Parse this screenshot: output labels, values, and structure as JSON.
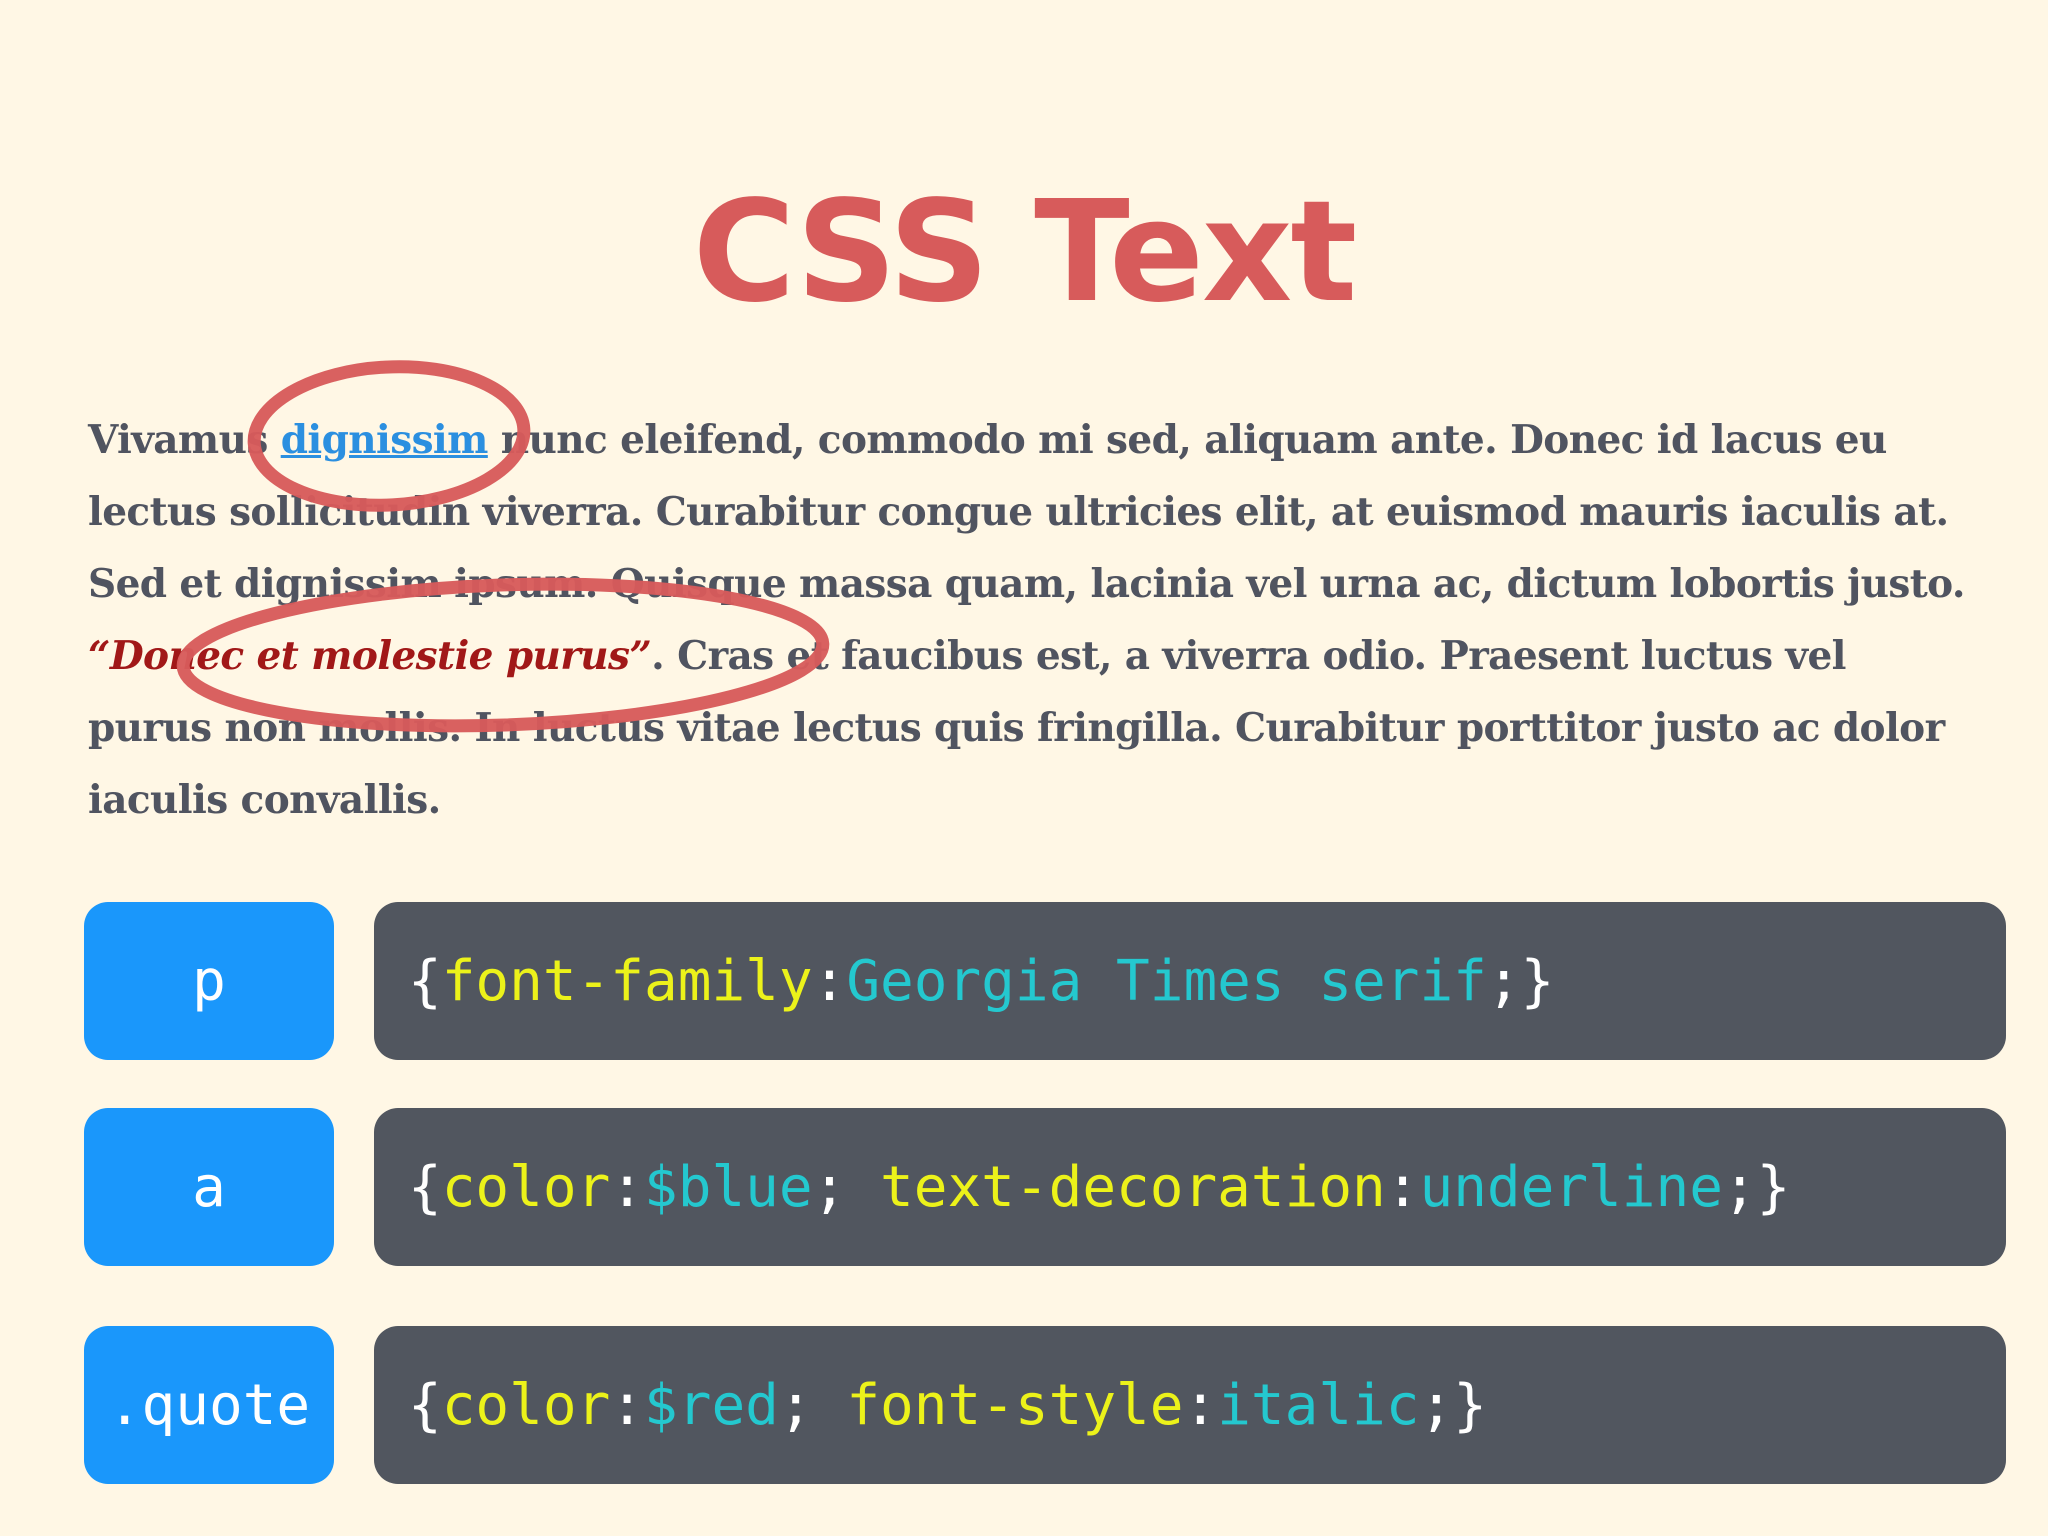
{
  "title": "CSS Text",
  "paragraph": {
    "before_link": "Vivamus ",
    "link": "dignissim",
    "after_link": " nunc eleifend, commodo mi sed, aliquam ante. Donec id lacus eu lectus sollicitudin viverra. Curabitur congue ultricies elit, at euismod mauris iaculis at. Sed et dignissim ipsum. Quisque massa quam, lacinia vel urna ac, dictum lobortis justo. ",
    "quote": "“Donec et molestie purus”",
    "after_quote": ". Cras et faucibus est, a viverra odio. Praesent luctus vel purus non mollis. In luctus vitae lectus quis fringilla. Curabitur porttitor justo ac dolor iaculis convallis."
  },
  "rules": [
    {
      "selector": "p",
      "open": "{",
      "prop1": "font-family",
      "colon1": ":",
      "val1": "Georgia Times serif",
      "semi1": ";",
      "prop2": "",
      "colon2": "",
      "val2": "",
      "semi2": "",
      "close": "}"
    },
    {
      "selector": "a",
      "open": "{",
      "prop1": "color",
      "colon1": ":",
      "val1": "$blue",
      "semi1": "; ",
      "prop2": "text-decoration",
      "colon2": ":",
      "val2": "underline",
      "semi2": ";",
      "close": "}"
    },
    {
      "selector": ".quote",
      "open": "{",
      "prop1": "color",
      "colon1": ":",
      "val1": "$red",
      "semi1": "; ",
      "prop2": "font-style",
      "colon2": ":",
      "val2": "italic",
      "semi2": ";",
      "close": "}"
    }
  ],
  "colors": {
    "background": "#fff7e5",
    "title": "#d75b5b",
    "body_text": "#505460",
    "link": "#2b8fe0",
    "quote": "#a11818",
    "annotation_circle": "#d75b5b",
    "selector_bg": "#1a97fb",
    "code_bg": "#51565f",
    "code_property": "#ecf21a",
    "code_value": "#24c8cf"
  }
}
